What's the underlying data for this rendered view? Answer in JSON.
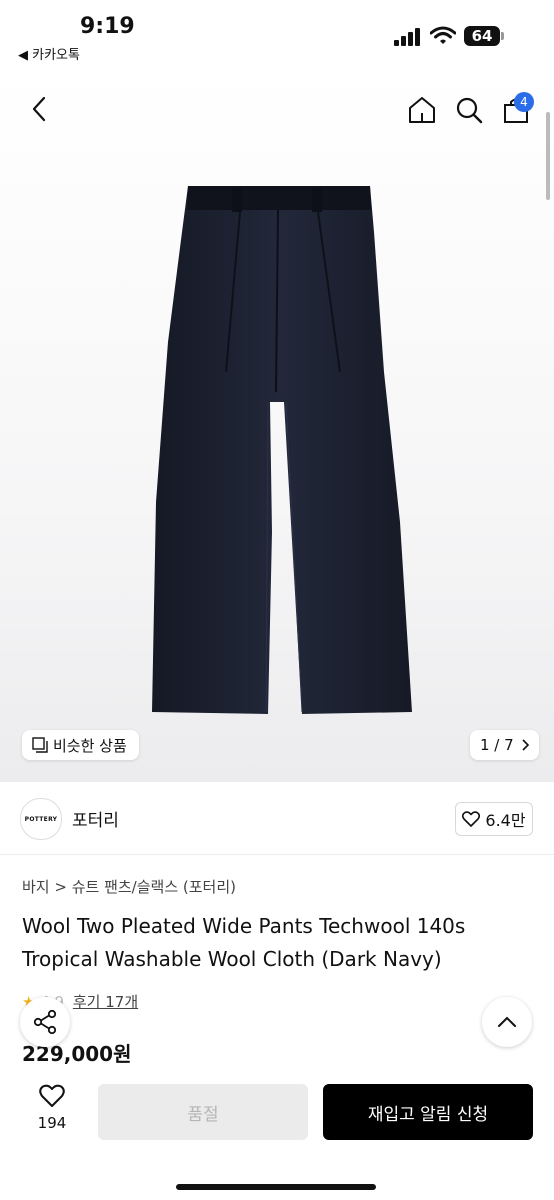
{
  "status_bar": {
    "time": "9:19",
    "back_app": "◀ 카카오톡",
    "battery": "64"
  },
  "nav": {
    "cart_count": "4",
    "icons": [
      "back-icon",
      "home-icon",
      "search-icon",
      "cart-icon"
    ]
  },
  "gallery": {
    "similar_label": "비슷한 상품",
    "page_indicator": "1 / 7"
  },
  "brand": {
    "logo_text": "POTTERY",
    "name": "포터리",
    "likes": "6.4만"
  },
  "product": {
    "breadcrumb": "바지 > 슈트 팬츠/슬랙스 (포터리)",
    "title": "Wool Two Pleated Wide Pants Techwool 140s Tropical Washable Wool Cloth (Dark Navy)",
    "rating_partial": "4.9",
    "reviews": "후기 17개",
    "price": "229,000원"
  },
  "bottom_bar": {
    "like_count": "194",
    "soldout_label": "품절",
    "restock_label": "재입고 알림 신청"
  },
  "colors": {
    "accent": "#2b6de8",
    "pants": "#1b1f2b",
    "star": "#f3b21a"
  }
}
